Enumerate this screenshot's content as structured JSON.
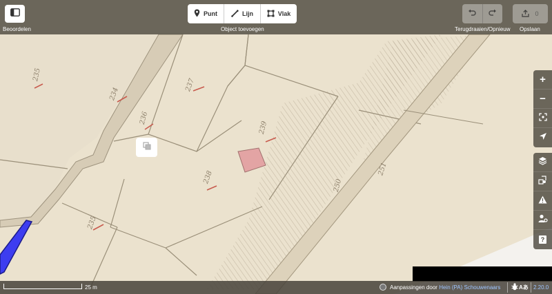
{
  "toolbar": {
    "sidebar_label": "Beoordelen",
    "add_group_label": "Object toevoegen",
    "add_point": "Punt",
    "add_line": "Lijn",
    "add_area": "Vlak",
    "undo_redo_label": "Terugdraaien/Opnieuw",
    "save_count": "0",
    "save_label": "Opslaan"
  },
  "map_labels": {
    "p1": "235",
    "p2": "234",
    "p3": "237",
    "p4": "236",
    "p5": "239",
    "p6": "238",
    "p7": "235",
    "p8": "250",
    "p9": "251"
  },
  "map_controls": {
    "zoom_in": "+",
    "zoom_out": "−",
    "help": "?"
  },
  "footer": {
    "scale": "25 m",
    "attribution_prefix": "Aanpassingen door",
    "attribution_user": "Hein (PA) Schouwenaars",
    "language": "Aあ",
    "version": "2.20.0"
  },
  "colors": {
    "bar": "#46423a",
    "link": "#9ec5ff",
    "highlight_fill": "#e3a4a4",
    "selection_blue": "#3d3df0"
  },
  "icons": {
    "sidebar": "sidebar-toggle-icon",
    "point": "map-pin-icon",
    "line": "pencil-line-icon",
    "area": "polygon-icon",
    "undo": "undo-icon",
    "redo": "redo-icon",
    "save": "upload-icon"
  }
}
